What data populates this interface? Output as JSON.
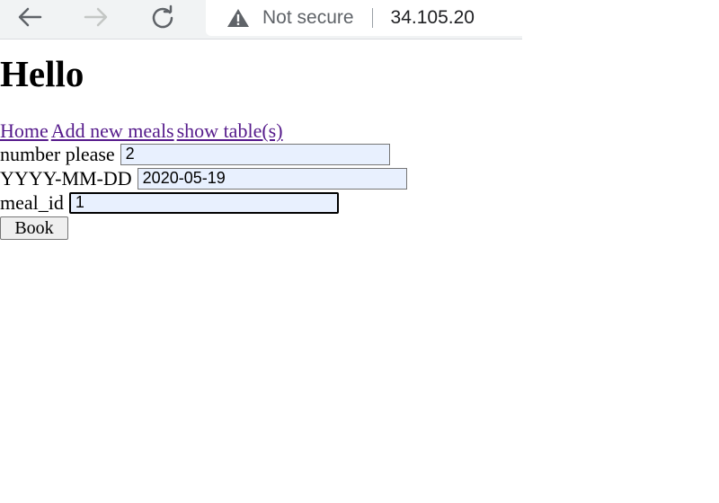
{
  "browser": {
    "security_text": "Not secure",
    "url": "34.105.20"
  },
  "page": {
    "heading": "Hello",
    "nav_links": [
      {
        "label": "Home"
      },
      {
        "label": "Add new meals"
      },
      {
        "label": "show table(s)"
      }
    ],
    "form": {
      "number_label": "number please",
      "number_value": "2",
      "date_label": "YYYY-MM-DD",
      "date_value": "2020-05-19",
      "meal_label": "meal_id",
      "meal_value": "1",
      "submit_label": "Book"
    }
  },
  "icons": {
    "back": "arrow-left-icon",
    "forward": "arrow-right-icon",
    "reload": "reload-icon",
    "security": "warning-triangle-icon"
  },
  "colors": {
    "link_visited": "#551a8b",
    "autofill_background": "#e8f0fe",
    "chrome_background": "#f1f3f4"
  }
}
